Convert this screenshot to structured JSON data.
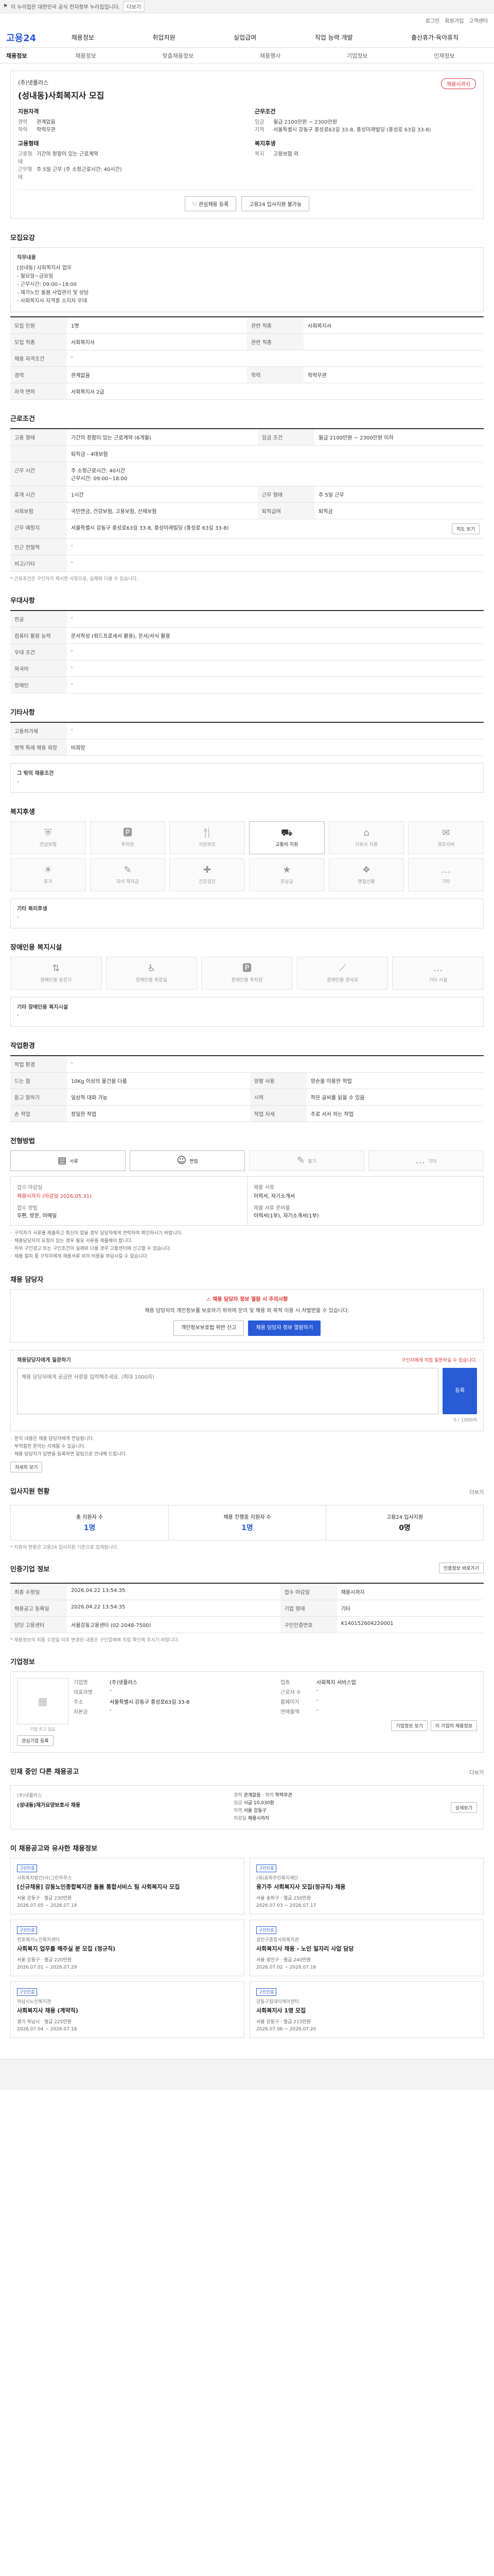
{
  "topbar": {
    "notice": "이 누리집은 대한민국 공식 전자정부 누리집입니다.",
    "toggle": "더보기"
  },
  "util": [
    "로그인",
    "회원가입",
    "고객센터"
  ],
  "header": {
    "logo": "고용24",
    "menu": [
      "채용정보",
      "취업지원",
      "실업급여",
      "직업 능력 개발",
      "출산휴가·육아휴직"
    ]
  },
  "snb": {
    "title": "채용정보",
    "items": [
      "채용정보",
      "맞춤채용정보",
      "채용행사",
      "기업정보",
      "인재정보"
    ]
  },
  "job": {
    "company": "(주)넷플러스",
    "title": "(성내동)사회복지사 모집",
    "dday": "채용시까지",
    "left_heading": "지원자격",
    "left_rows": [
      {
        "k": "경력",
        "v": "관계없음"
      },
      {
        "k": "학력",
        "v": "학력무관"
      }
    ],
    "left2_heading": "고용형태",
    "left2_rows": [
      {
        "k": "고용형태",
        "v": "기간의 정함이 있는 근로계약"
      },
      {
        "k": "근무형태",
        "v": "주 5일 근무 (주 소정근로시간: 40시간)"
      }
    ],
    "right_heading": "근무조건",
    "right_rows": [
      {
        "k": "임금",
        "v": "월급 2100만원 ~ 2300만원"
      },
      {
        "k": "지역",
        "v": "서울특별시 강동구 풍성로63길 33-8, 풍성미래빌딩 (풍성로 63길 33-8)"
      }
    ],
    "right2_heading": "복지후생",
    "right2_rows": [
      {
        "k": "복지",
        "v": "고용보험 외"
      }
    ],
    "btn_save": "관심채용 등록",
    "btn_apply": "고용24 입사지원 불가능"
  },
  "sections": {
    "recruit": "모집요강",
    "condition": "근로조건",
    "prefer": "우대사항",
    "other": "기타사항",
    "welfare": "복지후생",
    "disabled": "장애인용 복지시설",
    "workenv": "작업환경",
    "method": "전형방법",
    "contact": "채용 담당자",
    "applicant": "입사지원 현황",
    "info": "인증기업 정보",
    "corp": "기업정보",
    "others": "인재 중인 다른 채용공고",
    "reco": "이 채용공고와 유사한 채용정보"
  },
  "recruit": {
    "duty_label": "직무내용",
    "duty_text": "[성내동] 사회복지사 업무\n- 월요일~금요일\n- 근무시간: 09:00~18:00\n- 재가노인 돌봄 사업관리 및 상담\n- 사회복지사 자격증 소지자 우대",
    "rows": [
      {
        "k": "모집 인원",
        "v": "1명",
        "k2": "관련 직종",
        "v2": "사회복지사"
      },
      {
        "k": "모집 직종",
        "v": "사회복지사",
        "k2": "관련 직종",
        "v2": ""
      },
      {
        "k": "채용 자격조건",
        "v": "-",
        "k2": "",
        "v2": ""
      },
      {
        "k": "경력",
        "v": "관계없음",
        "k2": "학력",
        "v2": "학력무관"
      },
      {
        "k": "자격 면허",
        "v": "사회복지사 2급",
        "k2": "",
        "v2": ""
      }
    ]
  },
  "condition": {
    "rows": [
      {
        "k": "고용 형태",
        "v": "기간의 정함이 있는 근로계약 (6개월)",
        "k2": "임금 조건",
        "v2": "월급 2100만원 ~ 2300만원 이하"
      },
      {
        "k": "",
        "v": "퇴직금 - 4대보험",
        "k2": "",
        "v2": ""
      },
      {
        "k": "근무 시간",
        "v": "주 소정근로시간: 40시간\n근무시간: 09:00~18:00",
        "k2": "",
        "v2": ""
      },
      {
        "k": "휴게 시간",
        "v": "1시간",
        "k2": "근무 형태",
        "v2": "주 5일 근무"
      },
      {
        "k": "사회보험",
        "v": "국민연금, 건강보험, 고용보험, 산재보험",
        "k2": "퇴직급여",
        "v2": "퇴직금"
      },
      {
        "k": "근무 예정지",
        "v": "서울특별시 강동구 풍성로63길 33-8, 풍성미래빌딩 (풍성로 63길 33-8)",
        "k2": "",
        "v2": ""
      },
      {
        "k": "인근 전철역",
        "v": "-",
        "k2": "",
        "v2": ""
      },
      {
        "k": "비고/기타",
        "v": "-",
        "k2": "",
        "v2": ""
      }
    ],
    "map_btn": "지도 보기",
    "note": "* 근로조건은 구인자가 제시한 사항으로, 실제와 다를 수 있습니다."
  },
  "prefer": {
    "rows": [
      {
        "k": "전공",
        "v": "-"
      },
      {
        "k": "컴퓨터 활용 능력",
        "v": "문서작성 (워드프로세서 활용), 문서/서식 활용"
      },
      {
        "k": "우대 조건",
        "v": "-"
      },
      {
        "k": "외국어",
        "v": "-"
      },
      {
        "k": "장애인",
        "v": "-"
      }
    ]
  },
  "other": {
    "rows": [
      {
        "k": "고용허가제",
        "v": "-"
      },
      {
        "k": "병역 특례 채용 희망",
        "v": "비희망"
      }
    ],
    "extra_label": "그 밖의 채용조건",
    "extra_value": "-"
  },
  "welfare": {
    "items": [
      {
        "name": "연금보험",
        "glyph": "⛨",
        "on": false
      },
      {
        "name": "주차장",
        "glyph": "🅿",
        "on": false
      },
      {
        "name": "식당보조",
        "glyph": "🍴",
        "on": false
      },
      {
        "name": "교통비 지원",
        "glyph": "⛟",
        "on": true
      },
      {
        "name": "기숙사 지원",
        "glyph": "⌂",
        "on": false
      },
      {
        "name": "경조사비",
        "glyph": "✉",
        "on": false
      },
      {
        "name": "휴가",
        "glyph": "☀",
        "on": false
      },
      {
        "name": "자녀 학자금",
        "glyph": "✎",
        "on": false
      },
      {
        "name": "건강검진",
        "glyph": "✚",
        "on": false
      },
      {
        "name": "포상금",
        "glyph": "★",
        "on": false
      },
      {
        "name": "명절선물",
        "glyph": "❖",
        "on": false
      },
      {
        "name": "기타",
        "glyph": "…",
        "on": false
      }
    ],
    "etc_label": "기타 복리후생",
    "etc_value": "-"
  },
  "disabled": {
    "items": [
      {
        "name": "장애인용 승강기",
        "glyph": "⇅"
      },
      {
        "name": "장애인용 화장실",
        "glyph": "♿"
      },
      {
        "name": "장애인용 주차장",
        "glyph": "🅿"
      },
      {
        "name": "장애인용 경사로",
        "glyph": "⟋"
      },
      {
        "name": "기타 시설",
        "glyph": "…"
      }
    ],
    "etc_label": "기타 장애인용 복지시설",
    "etc_value": "-"
  },
  "workenv": {
    "rows": [
      {
        "k": "작업 환경",
        "v": "-",
        "k2": "",
        "v2": ""
      },
      {
        "k": "드는 힘",
        "v": "10Kg 이상의 물건을 다룸",
        "k2": "양팔 사용",
        "v2": "양손을 이용한 작업"
      },
      {
        "k": "듣고 말하기",
        "v": "일상적 대화 가능",
        "k2": "시력",
        "v2": "작은 글씨를 읽을 수 있음"
      },
      {
        "k": "손 작업",
        "v": "정밀한 작업",
        "k2": "작업 자세",
        "v2": "주로 서서 하는 작업"
      }
    ]
  },
  "method": {
    "steps": [
      {
        "name": "서류",
        "glyph": "▤",
        "on": true
      },
      {
        "name": "면접",
        "glyph": "☺",
        "on": true
      },
      {
        "name": "필기",
        "glyph": "✎",
        "on": false
      },
      {
        "name": "기타",
        "glyph": "…",
        "on": false
      }
    ],
    "left_k1": "접수 마감일",
    "left_v1": "채용시까지 (마감일 2026.05.31)",
    "left_k2": "접수 방법",
    "left_v2": "우편, 방문, 이메일",
    "right_k1": "제출 서류",
    "right_v1": "이력서, 자기소개서",
    "right_k2": "제출 서류 준비물",
    "right_v2": "이력서(1부), 자기소개서(1부)",
    "bullets": [
      "구직자가 서류를 제출하고 회신이 없을 경우 담당자에게 연락하여 확인하시기 바랍니다.",
      "채용담당자의 요청이 있는 경우 필요 서류를 제출해야 합니다.",
      "허위 구인광고 또는 구인조건이 실제와 다를 경우 고용센터에 신고할 수 있습니다.",
      "채용 절차 중 구직자에게 채용서류 외의 비용을 부담시킬 수 없습니다."
    ]
  },
  "contact": {
    "banner_title": "채용 담당자 정보 열람 시 주의사항",
    "banner_text": "채용 담당자의 개인정보를 보호하기 위하여 문의 및 채용 외 목적 이용 시 처벌받을 수 있습니다.",
    "btn_report": "개인정보보호법 위반 신고",
    "btn_view": "채용 담당자 정보 열람하기",
    "ask_label": "채용담당자에게 질문하기",
    "ask_hint": "구인자에게 직접 질문하실 수 있습니다.",
    "ask_placeholder": "채용 담당자에게 궁금한 사항을 입력해주세요. (최대 1000자)",
    "ask_btn": "등록",
    "ask_count": "0 / 1000자",
    "bullets": [
      "문의 내용은 채용 담당자에게 전달됩니다.",
      "부적절한 문의는 삭제될 수 있습니다.",
      "채용 담당자가 답변을 등록하면 알림으로 안내해 드립니다."
    ],
    "more_btn": "자세히 보기"
  },
  "applicant": {
    "more": "더보기",
    "stats": [
      {
        "k": "총 지원자 수",
        "v": "1명"
      },
      {
        "k": "채용 진행중 지원자 수",
        "v": "1명"
      },
      {
        "k": "고용24 입사지원",
        "v": "0명"
      }
    ],
    "note": "* 지원자 현황은 고용24 입사지원 기준으로 집계됩니다."
  },
  "info": {
    "print_btn": "인증정보 바로가기",
    "rows": [
      {
        "k": "최종 수정일",
        "v": "2026.04.22 13:54:35",
        "k2": "접수 마감일",
        "v2": "채용시까지"
      },
      {
        "k": "채용공고 등록일",
        "v": "2026.04.22 13:54:35",
        "k2": "기업 형태",
        "v2": "기타"
      },
      {
        "k": "담당 고용센터",
        "v": "서울강동고용센터 (02-2048-7500)",
        "k2": "구인인증번호",
        "v2": "K140152604220001"
      }
    ],
    "note": "* 채용정보의 최종 수정일 이후 변경된 내용은 구인업체에 직접 확인해 주시기 바랍니다."
  },
  "corp": {
    "logo_alt": "기업 로고 없음",
    "rows": [
      {
        "k": "기업명",
        "v": "(주)넷플러스"
      },
      {
        "k": "업종",
        "v": "사회복지 서비스업"
      },
      {
        "k": "대표자명",
        "v": "-"
      },
      {
        "k": "근로자 수",
        "v": "-"
      },
      {
        "k": "주소",
        "v": "서울특별시 강동구 풍성로63길 33-8"
      },
      {
        "k": "홈페이지",
        "v": "-"
      },
      {
        "k": "자본금",
        "v": "-"
      },
      {
        "k": "연매출액",
        "v": "-"
      }
    ],
    "btn_info": "기업정보 보기",
    "btn_subscribe": "관심기업 등록",
    "btn_hire": "이 기업의 채용정보"
  },
  "others": {
    "company": "(주)넷플러스",
    "title": "(성내동)재가요양보호사 채용",
    "k1": "경력",
    "v1": "관계없음",
    "k2": "학력",
    "v2": "학력무관",
    "k3": "임금",
    "v3": "시급 10,030원",
    "k4": "지역",
    "v4": "서울 강동구",
    "k5": "마감일",
    "v5": "채용시까지",
    "btn": "상세보기",
    "more": "더보기"
  },
  "reco": [
    {
      "tag": "구인인증",
      "co": "사회복지법인(사)그린하우스",
      "title": "[신규채용] 강동노인종합복지관 돌봄 통합서비스 팀 사회복지사 모집",
      "loc": "서울 강동구",
      "pay": "월급 230만원",
      "date": "2026.07.05 ~ 2026.07.19"
    },
    {
      "tag": "구인인증",
      "co": "(재)송파주민복지재단",
      "title": "용기주 사회복지사 모집(정규직) 채용",
      "loc": "서울 송파구",
      "pay": "월급 250만원",
      "date": "2026.07.03 ~ 2026.07.17"
    },
    {
      "tag": "구인인증",
      "co": "천호재가노인복지센터",
      "title": "사회복지 업무를 해주실 분 모집 (정규직)",
      "loc": "서울 강동구",
      "pay": "월급 220만원",
      "date": "2026.07.01 ~ 2026.07.29"
    },
    {
      "tag": "구인인증",
      "co": "광진구종합사회복지관",
      "title": "사회복지사 채용 - 노인 일자리 사업 담당",
      "loc": "서울 광진구",
      "pay": "월급 240만원",
      "date": "2026.07.02 ~ 2026.07.16"
    },
    {
      "tag": "구인인증",
      "co": "하남시노인복지관",
      "title": "사회복지사 채용 (계약직)",
      "loc": "경기 하남시",
      "pay": "월급 225만원",
      "date": "2026.07.04 ~ 2026.07.18"
    },
    {
      "tag": "구인인증",
      "co": "강동구립데이케어센터",
      "title": "사회복지사 1명 모집",
      "loc": "서울 강동구",
      "pay": "월급 215만원",
      "date": "2026.07.06 ~ 2026.07.20"
    }
  ]
}
